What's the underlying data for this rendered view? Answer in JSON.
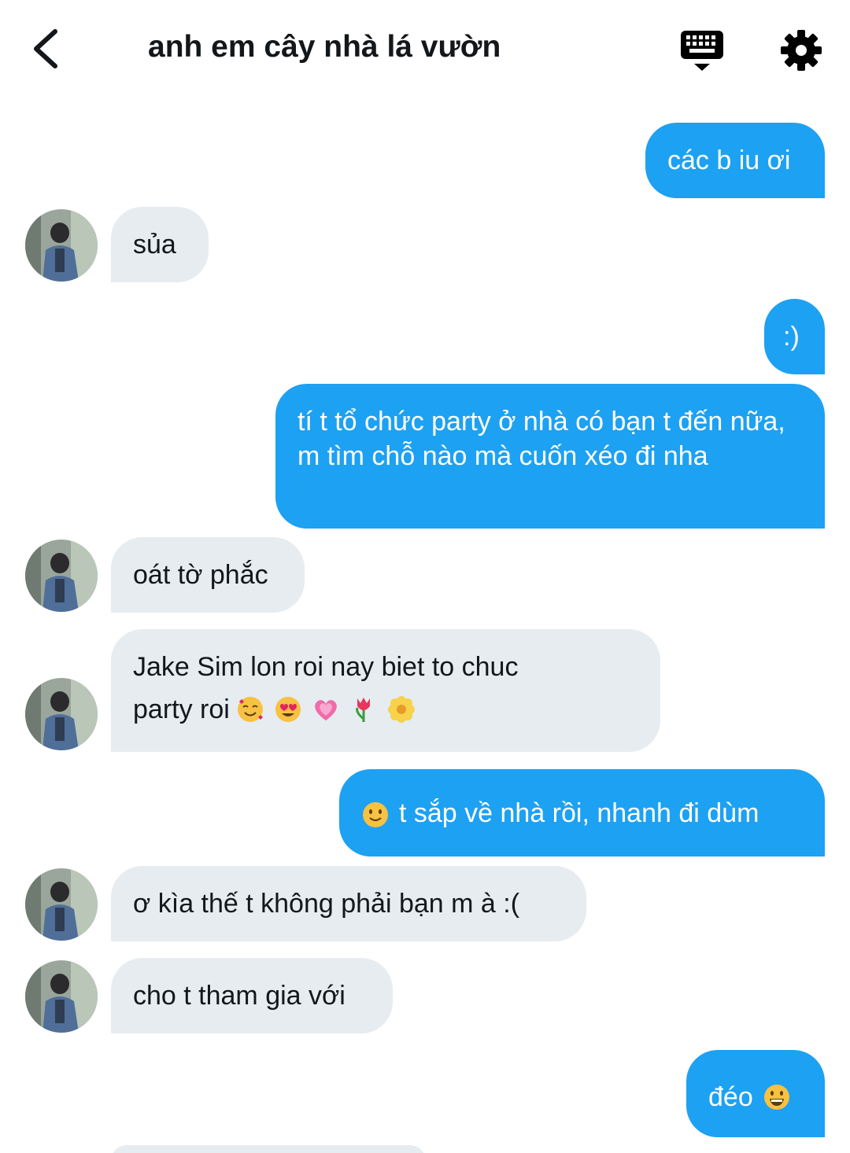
{
  "header": {
    "title": "anh em cây nhà lá vườn",
    "back_icon": "chevron-left-icon",
    "keyboard_icon": "keyboard-icon",
    "settings_icon": "gear-icon"
  },
  "colors": {
    "outgoing_bubble": "#1da1f2",
    "incoming_bubble": "#e6ecf0",
    "text_dark": "#14171a"
  },
  "messages": [
    {
      "side": "out",
      "text": "các b iu ơi"
    },
    {
      "side": "in",
      "text": "sủa"
    },
    {
      "side": "out",
      "text": ":)"
    },
    {
      "side": "out",
      "text": "tí t tổ chức party ở nhà có bạn t đến nữa, m tìm chỗ nào mà cuốn xéo đi nha"
    },
    {
      "side": "in",
      "text": "oát tờ phắc"
    },
    {
      "side": "in",
      "text": "Jake Sim lon roi nay biet to chuc",
      "text2": "party roi",
      "emojis": [
        "smiling-face-with-hearts-icon",
        "heart-eyes-icon",
        "growing-heart-icon",
        "tulip-icon",
        "blossom-icon"
      ]
    },
    {
      "side": "out",
      "text": "t sắp về nhà rồi, nhanh đi dùm",
      "lead_emoji": "slightly-smiling-face-icon"
    },
    {
      "side": "in",
      "text": "ơ kìa thế t không phải bạn m à :("
    },
    {
      "side": "in",
      "text": "cho t tham gia với"
    },
    {
      "side": "out",
      "text": "đéo",
      "trail_emoji": "grinning-face-icon"
    }
  ]
}
